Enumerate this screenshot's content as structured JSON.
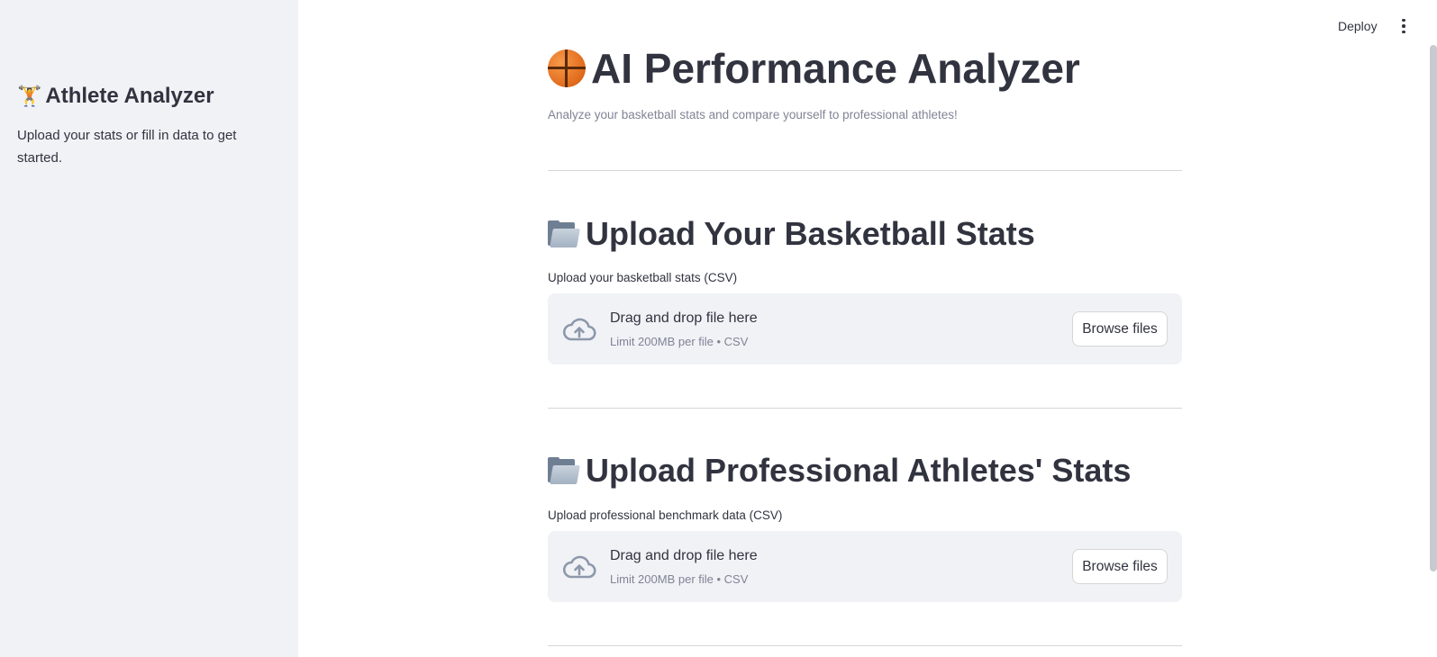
{
  "sidebar": {
    "title_emoji": "🏋️",
    "title": "Athlete Analyzer",
    "text": "Upload your stats or fill in data to get started."
  },
  "topbar": {
    "deploy_label": "Deploy",
    "menu_icon": "more-vertical-icon"
  },
  "main": {
    "title_emoji": "🏀",
    "title": "AI Performance Analyzer",
    "caption": "Analyze your basketball stats and compare yourself to professional athletes!",
    "sections": [
      {
        "icon": "folder-icon",
        "heading": "Upload Your Basketball Stats",
        "label": "Upload your basketball stats (CSV)",
        "dropzone_title": "Drag and drop file here",
        "dropzone_limit": "Limit 200MB per file • CSV",
        "browse_label": "Browse files"
      },
      {
        "icon": "folder-icon",
        "heading": "Upload Professional Athletes' Stats",
        "label": "Upload professional benchmark data (CSV)",
        "dropzone_title": "Drag and drop file here",
        "dropzone_limit": "Limit 200MB per file • CSV",
        "browse_label": "Browse files"
      }
    ]
  },
  "colors": {
    "sidebar_bg": "#f0f2f6",
    "text": "#31333f",
    "muted": "#808495",
    "dropzone_bg": "#f0f2f6"
  }
}
